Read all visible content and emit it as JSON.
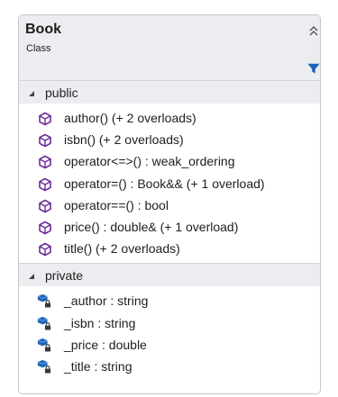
{
  "class": {
    "name": "Book",
    "stereotype": "Class"
  },
  "sections": {
    "public": {
      "label": "public",
      "members": [
        "author() (+ 2 overloads)",
        "isbn() (+ 2 overloads)",
        "operator<=>() : weak_ordering",
        "operator=() : Book&& (+ 1 overload)",
        "operator==() : bool",
        "price() : double& (+ 1 overload)",
        "title() (+ 2 overloads)"
      ]
    },
    "private": {
      "label": "private",
      "members": [
        "_author : string",
        "_isbn : string",
        "_price : double",
        "_title : string"
      ]
    }
  },
  "icons": {
    "method": "method-cube-icon",
    "private_field": "private-field-icon",
    "collapse": "double-chevron-up-icon",
    "filter": "filter-funnel-icon",
    "section_toggle": "triangle-expanded-icon"
  },
  "colors": {
    "method_icon": "#6c2b9a",
    "field_icon": "#1e66b8",
    "lock": "#3a3a3a",
    "filter": "#1e66b8",
    "header_bg": "#ecedf0"
  }
}
